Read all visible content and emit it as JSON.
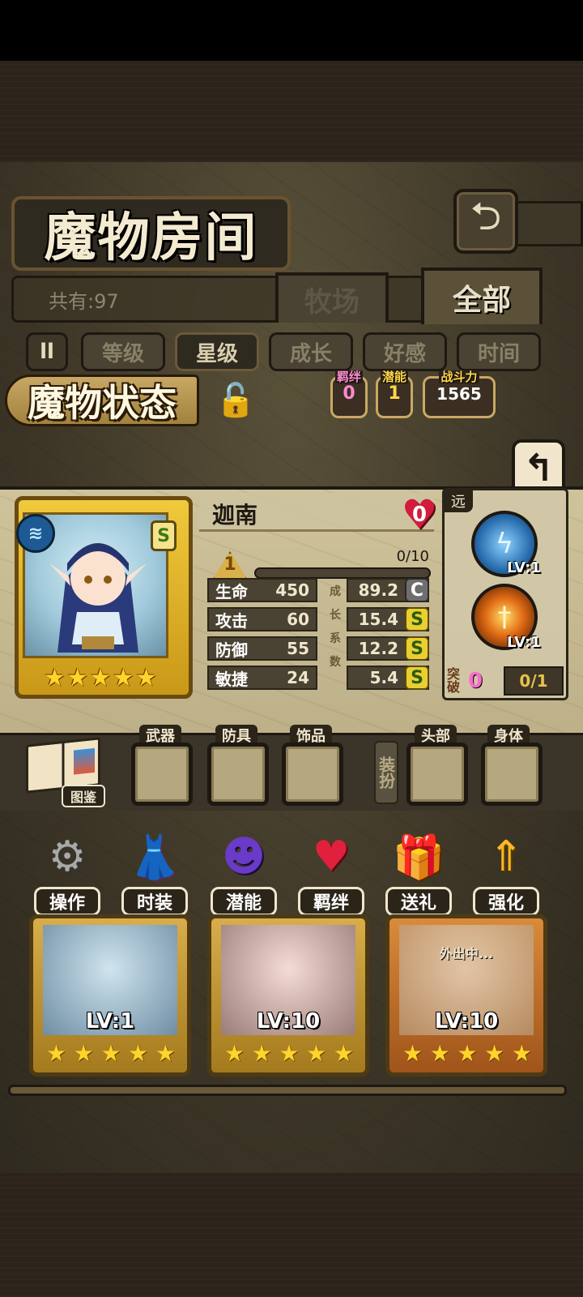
{
  "room": {
    "title": "魔物房间",
    "back_icon": "return-arrow-icon",
    "count_text": "共有:97",
    "tab_farm": "牧场",
    "tab_all": "全部"
  },
  "sort": {
    "toggle_icon": "pause-sort-icon",
    "buttons": [
      "等级",
      "星级",
      "成长",
      "好感",
      "时间"
    ],
    "active": "星级"
  },
  "status": {
    "title": "魔物状态",
    "lock_icon": "unlocked-padlock-icon",
    "bond_label": "羁绊",
    "bond_value": "0",
    "potential_label": "潜能",
    "potential_value": "1",
    "power_label": "战斗力",
    "power_value": "1565",
    "back_icon": "return-arrow-icon"
  },
  "monster": {
    "name": "迦南",
    "affection": "0",
    "element_icon": "water-element-icon",
    "rank": "S",
    "stars": 5,
    "level": "1",
    "exp_text": "0/10",
    "exp_progress": 0,
    "stats": [
      {
        "name": "生命",
        "value": "450",
        "growth": "89.2",
        "grade": "C"
      },
      {
        "name": "攻击",
        "value": "60",
        "growth": "15.4",
        "grade": "S"
      },
      {
        "name": "防御",
        "value": "55",
        "growth": "12.2",
        "grade": "S"
      },
      {
        "name": "敏捷",
        "value": "24",
        "growth": "5.4",
        "grade": "S"
      }
    ],
    "growth_label": [
      "成",
      "长",
      "系",
      "数"
    ],
    "range": "远",
    "skills": [
      {
        "icon": "lightning-skill-icon",
        "level": "LV:1"
      },
      {
        "icon": "fire-sword-skill-icon",
        "level": "LV:1"
      }
    ],
    "breakout_label": "突破",
    "breakout_value": "0",
    "breakout_progress": "0/1"
  },
  "equipment": {
    "book_label": "图鉴",
    "slots": [
      "武器",
      "防具",
      "饰品"
    ],
    "dress_label": "装扮",
    "dress_slots": [
      "头部",
      "身体"
    ]
  },
  "actions": [
    {
      "label": "操作",
      "icon": "gear-icon"
    },
    {
      "label": "时装",
      "icon": "dress-icon"
    },
    {
      "label": "潜能",
      "icon": "demon-icon"
    },
    {
      "label": "羁绊",
      "icon": "hearts-icon"
    },
    {
      "label": "送礼",
      "icon": "gift-icon"
    },
    {
      "label": "强化",
      "icon": "up-arrows-icon"
    }
  ],
  "cards": [
    {
      "level": "LV:1",
      "stars": 5,
      "status": ""
    },
    {
      "level": "LV:10",
      "stars": 5,
      "status": ""
    },
    {
      "level": "LV:10",
      "stars": 5,
      "status": "外出中..."
    }
  ],
  "colors": {
    "accent_gold": "#e8c44a",
    "heart_red": "#d21c3c",
    "bond_pink": "#ff8ad0",
    "rank_s": "#e9cf2f",
    "rank_c": "#6e6e6e"
  }
}
